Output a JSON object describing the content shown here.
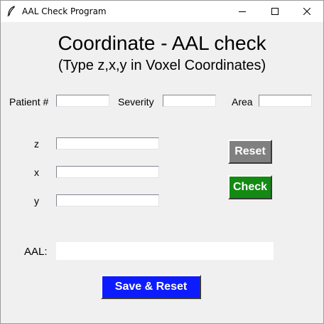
{
  "window": {
    "title": "AAL Check Program",
    "controls": [
      "minimize",
      "maximize",
      "close"
    ]
  },
  "header": {
    "title": "Coordinate - AAL check",
    "subtitle": "(Type z,x,y in Voxel Coordinates)"
  },
  "patient_row": {
    "patient_label": "Patient #",
    "patient_value": "",
    "severity_label": "Severity",
    "severity_value": "",
    "area_label": "Area",
    "area_value": ""
  },
  "coordinates": {
    "z_label": "z",
    "z_value": "",
    "x_label": "x",
    "x_value": "",
    "y_label": "y",
    "y_value": ""
  },
  "buttons": {
    "reset_label": "Reset",
    "check_label": "Check",
    "save_reset_label": "Save & Reset"
  },
  "aal": {
    "label": "AAL:",
    "value": ""
  },
  "colors": {
    "reset_button": "#808080",
    "check_button": "#138a13",
    "save_button": "#0d1cff",
    "window_background": "#f0f0f0"
  },
  "icons": {
    "app": "feather-icon",
    "minimize": "minimize-icon",
    "maximize": "maximize-icon",
    "close": "close-icon"
  }
}
